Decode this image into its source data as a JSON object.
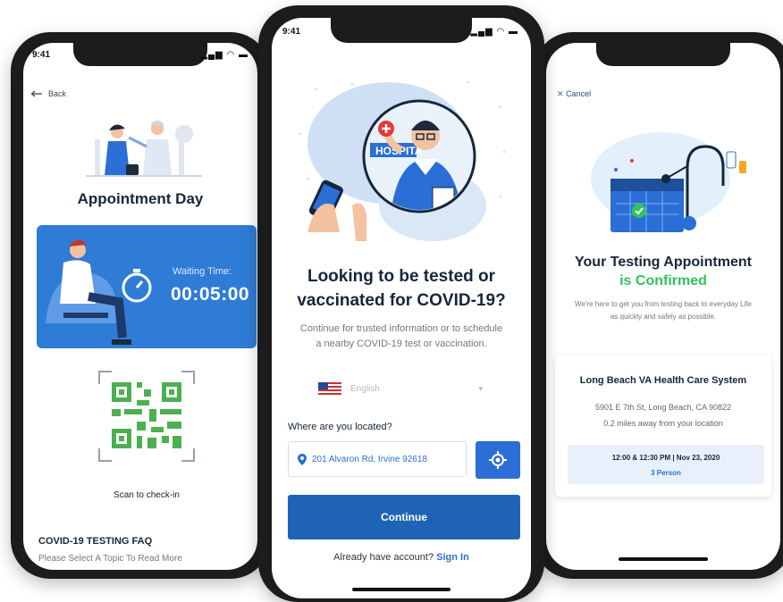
{
  "left_phone": {
    "status_time": "9:41",
    "back_label": "Back",
    "title": "Appointment Day",
    "waiting_label": "Waiting Time:",
    "waiting_time": "00:05:00",
    "scan_label": "Scan to check-in",
    "faq_title": "COVID-19 TESTING FAQ",
    "faq_subtitle": "Please Select A Topic To Read More"
  },
  "middle_phone": {
    "status_time": "9:41",
    "illustration_sign": "HOSPITA",
    "title_line1": "Looking to be tested or",
    "title_line2": "vaccinated for COVID-19?",
    "subtitle": "Continue for trusted information or to schedule a nearby COVID-19 test or vaccination.",
    "language": "English",
    "location_label": "Where are you located?",
    "location_value": "201 Alvaron Rd, Irvine 92618",
    "continue_label": "Continue",
    "account_prompt": "Already have account?",
    "signin_label": "Sign In"
  },
  "right_phone": {
    "cancel_label": "Cancel",
    "title_line1": "Your Testing Appointment",
    "title_line2": "is Confirmed",
    "subtitle": "We're here to get you from testing back to everyday Life as quickly and safely as possible.",
    "location_name": "Long Beach VA Health Care System",
    "address": "5901 E 7th St, Long Beach, CA 90822",
    "distance": "0.2 miles away from your location",
    "time_slot": "12:00 & 12:30 PM | Nov 23, 2020",
    "persons": "3 Person"
  },
  "colors": {
    "primary_blue": "#1f63b6",
    "accent_blue": "#2b6fd6",
    "confirm_green": "#2fc45a",
    "qr_green": "#4caf50",
    "dark_text": "#16263b"
  }
}
